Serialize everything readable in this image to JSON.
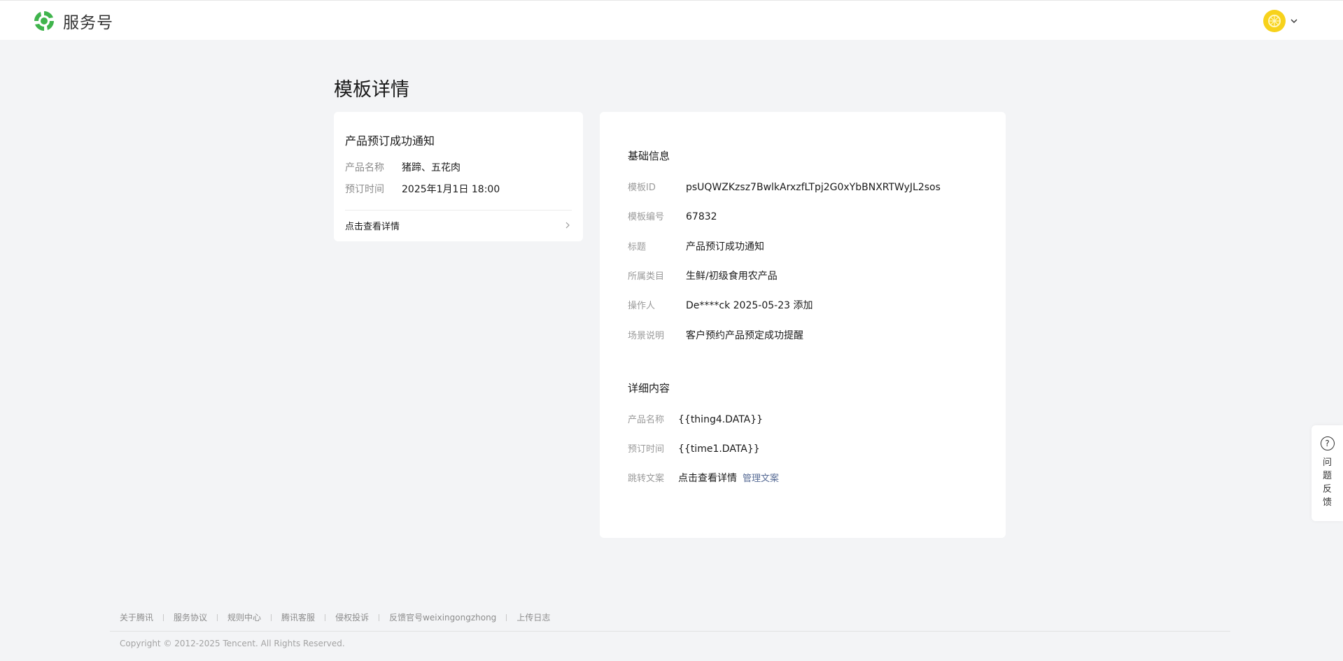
{
  "header": {
    "brand": "服务号",
    "colors": {
      "brand_green": "#3fb44c",
      "avatar_yellow": "#f7d21b"
    }
  },
  "page": {
    "title": "模板详情"
  },
  "preview": {
    "title": "产品预订成功通知",
    "rows": [
      {
        "key": "产品名称",
        "value": "猪蹄、五花肉"
      },
      {
        "key": "预订时间",
        "value": "2025年1月1日 18:00"
      }
    ],
    "link_text": "点击查看详情"
  },
  "basic_info": {
    "title": "基础信息",
    "rows": [
      {
        "key": "模板ID",
        "value": "psUQWZKzsz7BwlkArxzfLTpj2G0xYbBNXRTWyJL2sos"
      },
      {
        "key": "模板编号",
        "value": "67832"
      },
      {
        "key": "标题",
        "value": "产品预订成功通知"
      },
      {
        "key": "所属类目",
        "value": "生鲜/初级食用农产品"
      },
      {
        "key": "操作人",
        "value": "De****ck 2025-05-23 添加"
      },
      {
        "key": "场景说明",
        "value": "客户预约产品预定成功提醒"
      }
    ]
  },
  "detail_content": {
    "title": "详细内容",
    "rows": [
      {
        "key": "产品名称",
        "value": "{{thing4.DATA}}"
      },
      {
        "key": "预订时间",
        "value": "{{time1.DATA}}"
      },
      {
        "key": "跳转文案",
        "value": "点击查看详情",
        "link": "管理文案"
      }
    ]
  },
  "feedback": {
    "icon": "?",
    "label": "问题反馈"
  },
  "footer": {
    "links": [
      "关于腾讯",
      "服务协议",
      "规则中心",
      "腾讯客服",
      "侵权投诉",
      "反馈官号weixingongzhong",
      "上传日志"
    ],
    "copyright": "Copyright © 2012-2025 Tencent. All Rights Reserved."
  }
}
